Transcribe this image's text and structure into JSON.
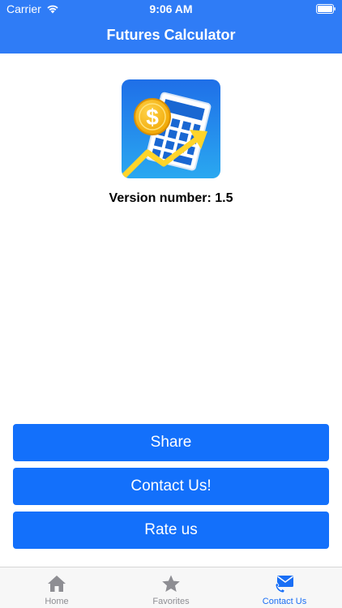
{
  "status_bar": {
    "carrier": "Carrier",
    "time": "9:06 AM"
  },
  "nav": {
    "title": "Futures Calculator"
  },
  "app_info": {
    "version": "Version number: 1.5",
    "icon": "calculator-dollar-icon"
  },
  "actions": {
    "share": "Share",
    "contact": "Contact Us!",
    "rate": "Rate us"
  },
  "tabbar": {
    "items": [
      {
        "label": "Home",
        "icon": "home-icon",
        "selected": false
      },
      {
        "label": "Favorites",
        "icon": "star-icon",
        "selected": false
      },
      {
        "label": "Contact Us",
        "icon": "envelope-phone-icon",
        "selected": true
      }
    ]
  },
  "colors": {
    "header": "#2f7cf6",
    "button": "#1370fb",
    "tab_active": "#1a6ff5",
    "tab_inactive": "#8e8e93"
  }
}
